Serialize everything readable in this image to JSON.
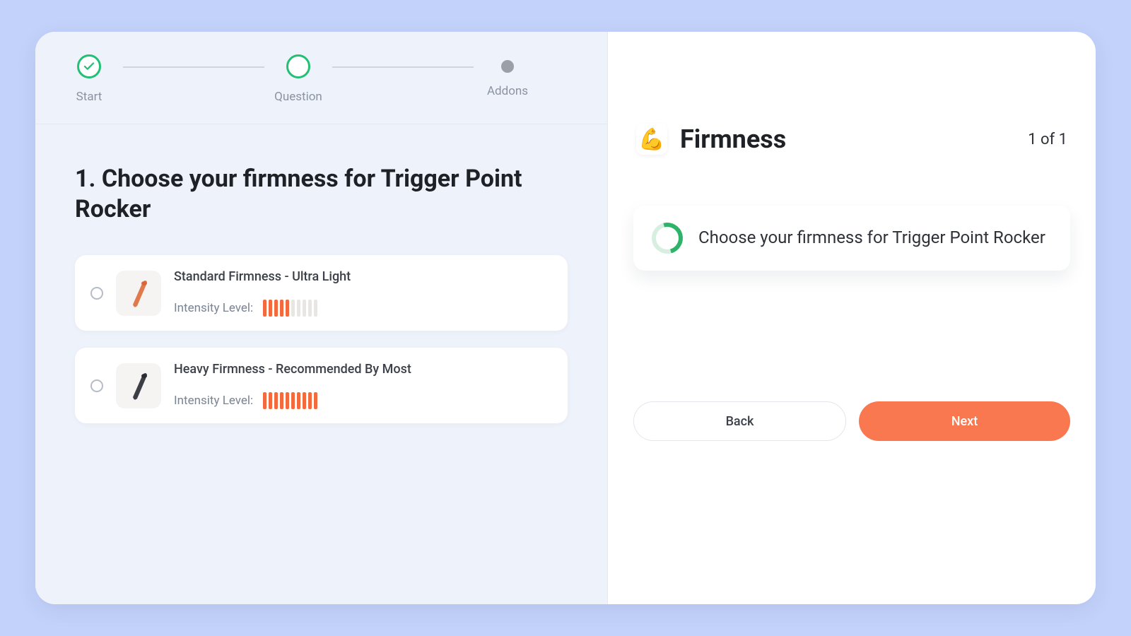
{
  "stepper": {
    "steps": [
      {
        "label": "Start",
        "state": "done"
      },
      {
        "label": "Question",
        "state": "active"
      },
      {
        "label": "Addons",
        "state": "inactive"
      }
    ]
  },
  "question": {
    "number": "1.",
    "title": "1. Choose your firmness for Trigger Point Rocker",
    "options": [
      {
        "title": "Standard Firmness - Ultra Light",
        "intensity_label": "Intensity Level:",
        "intensity_filled": 5,
        "intensity_total": 10,
        "thumb_color": "#e07a4c"
      },
      {
        "title": "Heavy Firmness - Recommended By Most",
        "intensity_label": "Intensity Level:",
        "intensity_filled": 10,
        "intensity_total": 10,
        "thumb_color": "#3b3f45"
      }
    ]
  },
  "sidebar": {
    "emoji": "💪",
    "title": "Firmness",
    "counter": "1 of 1",
    "summary": "Choose your firmness for Trigger Point Rocker"
  },
  "actions": {
    "back": "Back",
    "next": "Next"
  },
  "colors": {
    "accent_green": "#22c074",
    "accent_orange": "#f97850",
    "bar_on": "#f36a3e"
  }
}
